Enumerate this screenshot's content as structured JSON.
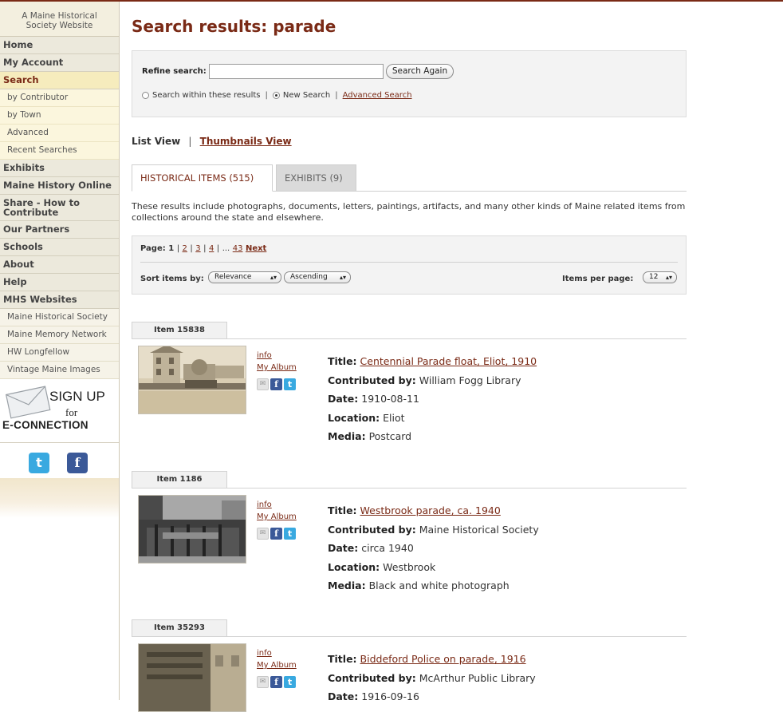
{
  "sidebar": {
    "site_tag_line1": "A Maine Historical",
    "site_tag_line2": "Society Website",
    "nav": {
      "home": "Home",
      "my_account": "My Account",
      "search": "Search",
      "by_contributor": "by Contributor",
      "by_town": "by Town",
      "advanced": "Advanced",
      "recent_searches": "Recent Searches",
      "exhibits": "Exhibits",
      "maine_history_online": "Maine History Online",
      "share": "Share - How to Contribute",
      "our_partners": "Our Partners",
      "schools": "Schools",
      "about": "About",
      "help": "Help",
      "mhs_websites": "MHS Websites",
      "maine_historical_society": "Maine Historical Society",
      "maine_memory_network": "Maine Memory Network",
      "hw_longfellow": "HW Longfellow",
      "vintage_maine_images": "Vintage Maine Images"
    },
    "signup": {
      "line1": "SIGN UP",
      "line2": "for",
      "line3": "E-CONNECTION"
    },
    "social": {
      "twitter_glyph": "t",
      "facebook_glyph": "f"
    }
  },
  "page": {
    "title": "Search results: parade"
  },
  "refine": {
    "label": "Refine search:",
    "input_value": "",
    "button": "Search Again",
    "opt_within": "Search within these results",
    "opt_new": "New Search",
    "advanced_link": "Advanced Search",
    "sep": "|"
  },
  "view": {
    "list": "List View",
    "thumbnails": "Thumbnails View",
    "sep": "|"
  },
  "tabs": {
    "historical": "HISTORICAL ITEMS (515)",
    "exhibits": "EXHIBITS (9)"
  },
  "description": "These results include photographs, documents, letters, paintings, artifacts, and many other kinds of Maine related items from collections around the state and elsewhere.",
  "pager": {
    "page_label": "Page:",
    "current": "1",
    "p2": "2",
    "p3": "3",
    "p4": "4",
    "ellipsis": "...",
    "last": "43",
    "next": "Next",
    "sep": "|",
    "sort_label": "Sort items by:",
    "sort_value": "Relevance",
    "order_value": "Ascending",
    "ipp_label": "Items per page:",
    "ipp_value": "12"
  },
  "item_ui": {
    "info": "info",
    "my_album": "My Album",
    "mail_glyph": "✉",
    "fb_glyph": "f",
    "tw_glyph": "t",
    "title_label": "Title:",
    "contrib_label": "Contributed by:",
    "date_label": "Date:",
    "location_label": "Location:",
    "media_label": "Media:"
  },
  "items": [
    {
      "id_label": "Item 15838",
      "title": "Centennial Parade float, Eliot, 1910",
      "contributed_by": "William Fogg Library",
      "date": "1910-08-11",
      "location": "Eliot",
      "media": "Postcard"
    },
    {
      "id_label": "Item 1186",
      "title": "Westbrook parade, ca. 1940",
      "contributed_by": "Maine Historical Society",
      "date": "circa 1940",
      "location": "Westbrook",
      "media": "Black and white photograph"
    },
    {
      "id_label": "Item 35293",
      "title": "Biddeford Police on parade, 1916",
      "contributed_by": "McArthur Public Library",
      "date": "1916-09-16"
    }
  ]
}
